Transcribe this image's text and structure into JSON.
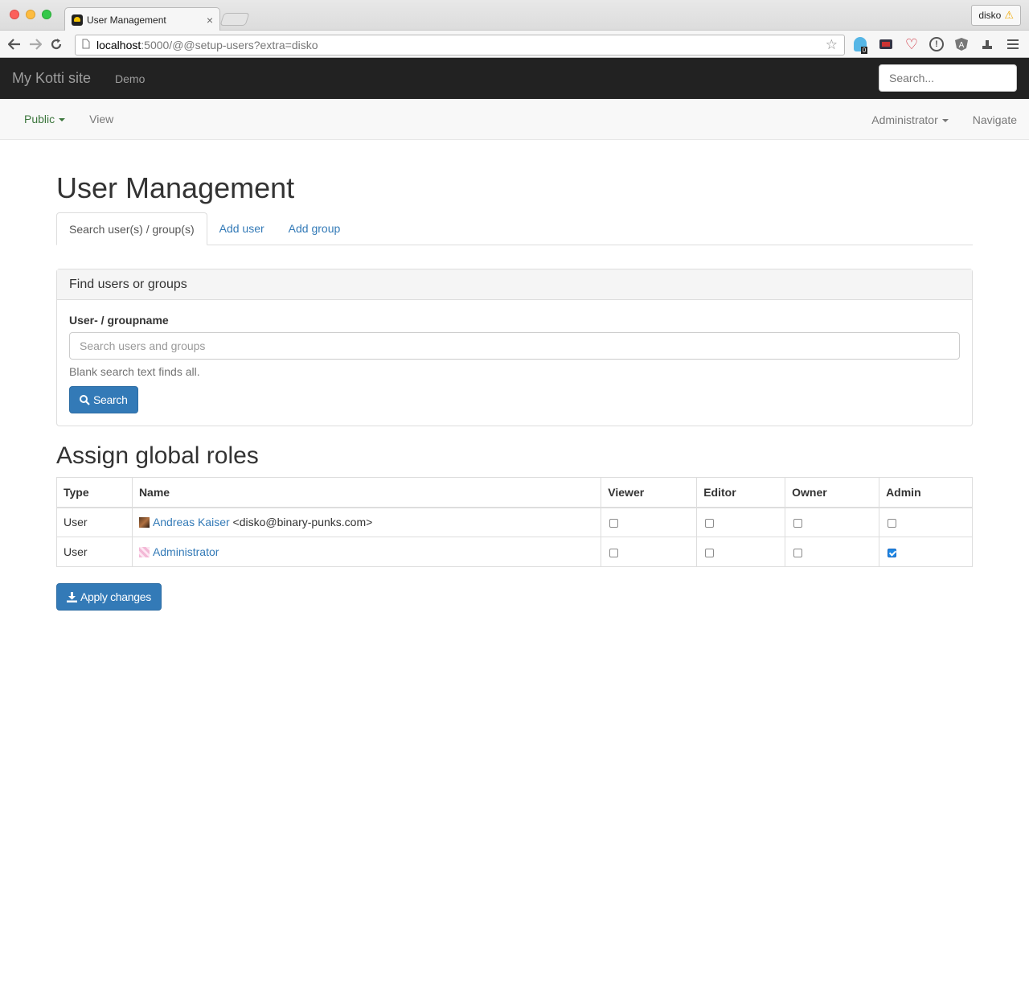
{
  "browser": {
    "tab_title": "User Management",
    "tab_close": "×",
    "profile_name": "disko",
    "url_host": "localhost",
    "url_path": ":5000/@@setup-users?extra=disko",
    "ext_badge": "0"
  },
  "navbar": {
    "brand": "My Kotti site",
    "links": [
      "Demo"
    ],
    "search_placeholder": "Search..."
  },
  "subnav": {
    "state_label": "Public",
    "view_label": "View",
    "user_label": "Administrator",
    "navigate_label": "Navigate"
  },
  "page": {
    "title": "User Management",
    "tabs": [
      {
        "label": "Search user(s) / group(s)",
        "active": true
      },
      {
        "label": "Add user",
        "active": false
      },
      {
        "label": "Add group",
        "active": false
      }
    ]
  },
  "find_panel": {
    "heading": "Find users or groups",
    "field_label": "User- / groupname",
    "placeholder": "Search users and groups",
    "value": "",
    "help_text": "Blank search text finds all.",
    "search_button": "Search"
  },
  "roles": {
    "title": "Assign global roles",
    "columns": [
      "Type",
      "Name",
      "Viewer",
      "Editor",
      "Owner",
      "Admin"
    ],
    "rows": [
      {
        "type": "User",
        "name": "Andreas Kaiser",
        "email": "<disko@binary-punks.com>",
        "viewer": false,
        "editor": false,
        "owner": false,
        "admin": false
      },
      {
        "type": "User",
        "name": "Administrator",
        "email": "",
        "viewer": false,
        "editor": false,
        "owner": false,
        "admin": true
      }
    ],
    "apply_button": "Apply changes"
  },
  "colors": {
    "navbar_bg": "#222222",
    "link": "#337ab7",
    "primary_button": "#337ab7",
    "state_public": "#3c763d"
  }
}
